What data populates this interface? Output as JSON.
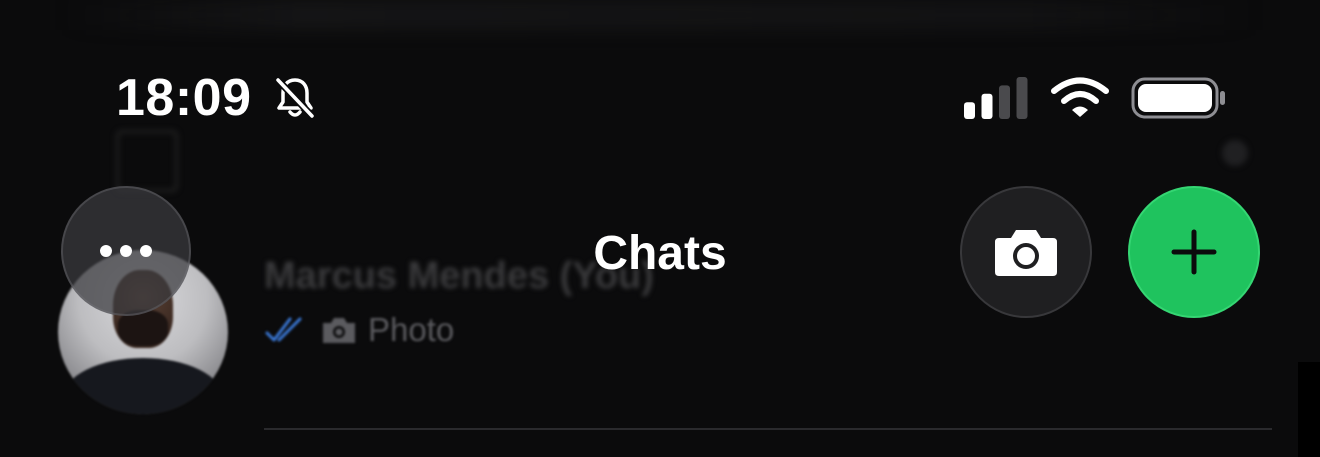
{
  "status_bar": {
    "time": "18:09",
    "silent_icon": "bell-slash-icon",
    "signal_icon": "cellular-signal-icon",
    "signal_bars_active": 2,
    "signal_bars_total": 4,
    "wifi_icon": "wifi-icon",
    "battery_icon": "battery-icon",
    "battery_level": 1.0
  },
  "nav": {
    "title": "Chats",
    "more_button_icon": "ellipsis-icon",
    "camera_button_icon": "camera-icon",
    "new_chat_button_icon": "plus-icon"
  },
  "chat_list": {
    "items": [
      {
        "name": "Marcus Mendes (You)",
        "preview_status_icon": "double-check-icon",
        "preview_media_icon": "camera-icon",
        "preview_text": "Photo"
      }
    ]
  },
  "colors": {
    "background": "#0b0b0c",
    "accent_green": "#1fc35e",
    "read_tick_blue": "#3a78d6"
  }
}
